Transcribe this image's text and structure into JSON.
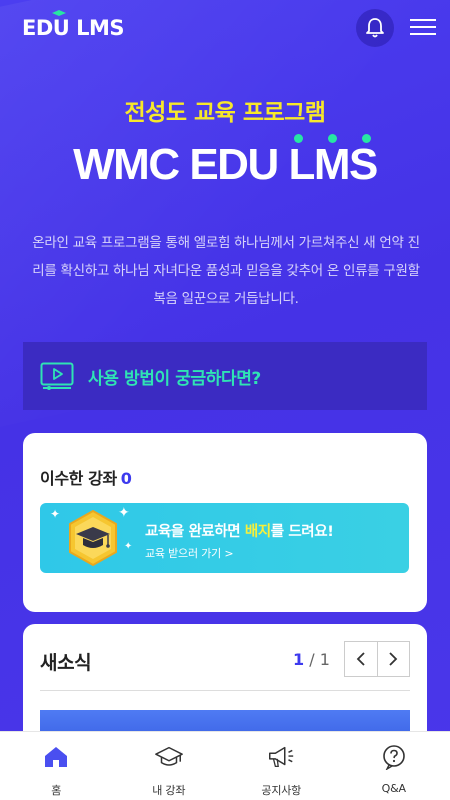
{
  "header": {
    "logo": "EDU LMS",
    "notifications_icon": "bell-icon",
    "menu_icon": "hamburger-menu-icon"
  },
  "hero": {
    "subtitle": "전성도 교육 프로그램",
    "title": "WMC EDU LMS",
    "description": "온라인 교육 프로그램을 통해 엘로힘 하나님께서 가르쳐주신 새 언약 진리를 확신하고 하나님 자녀다운 품성과 믿음을 갖추어 온 인류를 구원할 복음 일꾼으로 거듭납니다."
  },
  "howto": {
    "icon": "video-play-icon",
    "label": "사용 방법이 궁금하다면?"
  },
  "completed": {
    "label": "이수한 강좌",
    "count": "0",
    "banner": {
      "icon": "graduation-badge-icon",
      "text_before": "교육을 완료하면 ",
      "text_highlight": "배지",
      "text_after": "를 드려요!",
      "link": "교육 받으러 가기 >"
    }
  },
  "news": {
    "title": "새소식",
    "page_current": "1",
    "page_sep": " / ",
    "page_total": "1",
    "prev_icon": "chevron-left-icon",
    "next_icon": "chevron-right-icon"
  },
  "bottom_nav": [
    {
      "label": "홈",
      "icon": "home-icon",
      "active": true
    },
    {
      "label": "내 강좌",
      "icon": "graduation-cap-icon",
      "active": false
    },
    {
      "label": "공지사항",
      "icon": "megaphone-icon",
      "active": false
    },
    {
      "label": "Q&A",
      "icon": "question-icon",
      "active": false
    }
  ],
  "colors": {
    "background": "#4a36e8",
    "accent_yellow": "#f7e82a",
    "accent_mint": "#2fe3b4",
    "accent_blue": "#3d3aee",
    "badge_banner": "#2fc8e8"
  }
}
